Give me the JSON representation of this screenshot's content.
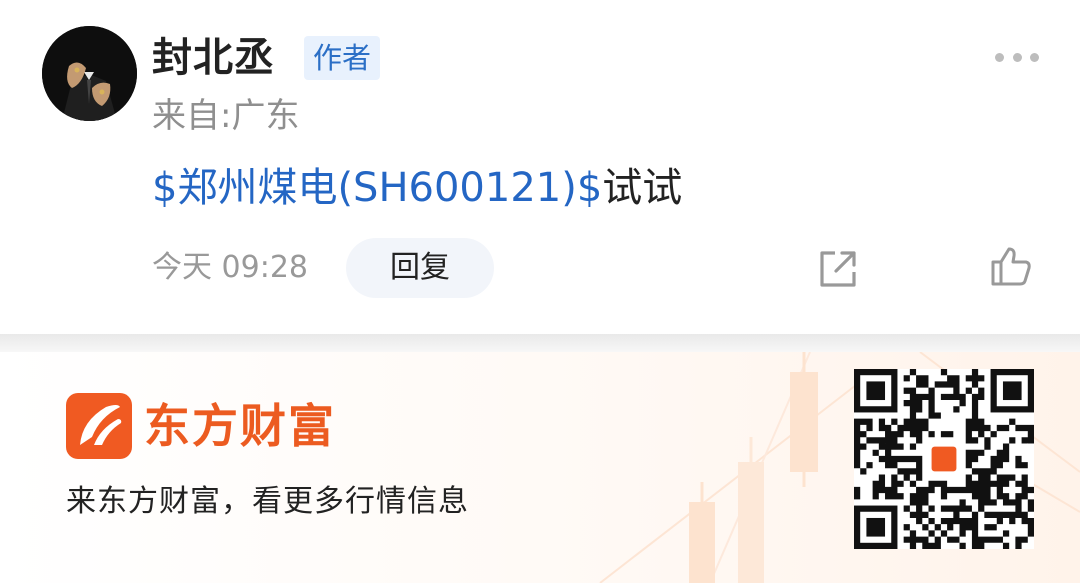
{
  "post": {
    "author": "封北丞",
    "author_badge": "作者",
    "location": "来自:广东",
    "content_stock": "$郑州煤电(SH600121)$",
    "content_text": "试试",
    "time": "今天 09:28",
    "reply_label": "回复"
  },
  "icons": {
    "avatar": "avatar-photo",
    "more": "more-dots-icon",
    "share": "share-icon",
    "like": "thumbs-up-icon",
    "logo": "eastmoney-logo-icon",
    "qr": "qr-code"
  },
  "footer": {
    "brand": "东方财富",
    "slogan": "来东方财富，看更多行情信息"
  },
  "colors": {
    "link": "#2466c4",
    "brand": "#f05a22",
    "badge_bg": "#e8f1fd",
    "badge_text": "#2b6fc6"
  }
}
